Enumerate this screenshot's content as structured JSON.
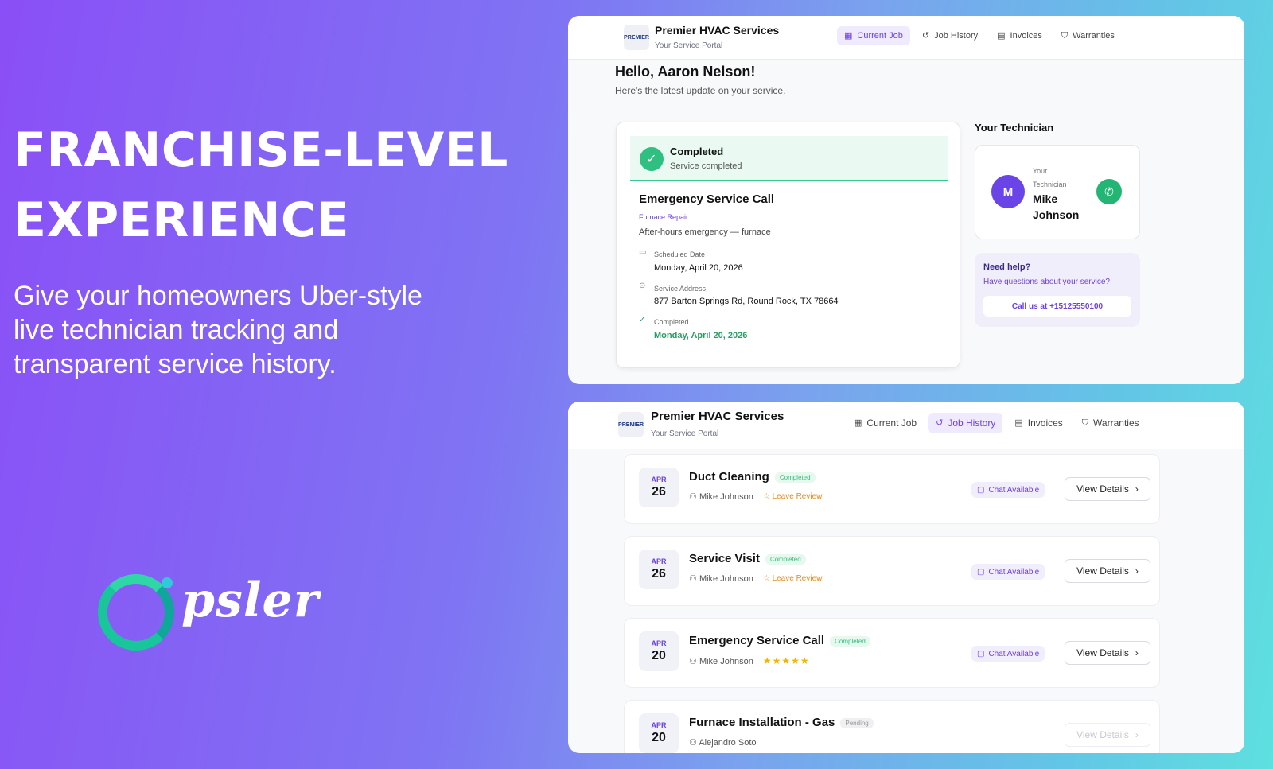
{
  "hero": {
    "headline_line1": "FRANCHISE-LEVEL",
    "headline_line2": "EXPERIENCE",
    "subtext": "Give your homeowners Uber-style live technician tracking and transparent service history."
  },
  "logo": {
    "text": "psler",
    "ring_color": "#19c59a"
  },
  "portal": {
    "brand_name": "Premier HVAC Services",
    "brand_sub": "Your Service Portal",
    "brand_logo_text": "PREMIER",
    "nav": {
      "current_job": "Current Job",
      "job_history": "Job History",
      "invoices": "Invoices",
      "warranties": "Warranties"
    },
    "accent_color": "#6d3fe6"
  },
  "current_job_view": {
    "greeting": "Hello, Aaron Nelson!",
    "greeting_sub": "Here's the latest update on your service.",
    "status_title": "Completed",
    "status_sub": "Service completed",
    "job_title": "Emergency Service Call",
    "job_category": "Furnace Repair",
    "job_description": "After-hours emergency — furnace",
    "scheduled_label": "Scheduled Date",
    "scheduled_value": "Monday, April 20, 2026",
    "address_label": "Service Address",
    "address_value": "877 Barton Springs Rd, Round Rock, TX 78664",
    "completed_label": "Completed",
    "completed_value": "Monday, April 20, 2026",
    "technician_heading": "Your Technician",
    "technician_label": "Your Technician",
    "technician_initial": "M",
    "technician_name": "Mike Johnson",
    "help_title": "Need help?",
    "help_question": "Have questions about your service?",
    "call_button": "Call us at +15125550100"
  },
  "job_history_view": {
    "chat_label": "Chat Available",
    "view_details_label": "View Details",
    "leave_review_label": "Leave Review",
    "rows": [
      {
        "month": "APR",
        "day": "26",
        "title": "Duct Cleaning",
        "status": "Completed",
        "technician": "Mike Johnson",
        "review": "Leave Review"
      },
      {
        "month": "APR",
        "day": "26",
        "title": "Service Visit",
        "status": "Completed",
        "technician": "Mike Johnson",
        "review": "Leave Review"
      },
      {
        "month": "APR",
        "day": "20",
        "title": "Emergency Service Call",
        "status": "Completed",
        "technician": "Mike Johnson",
        "rating": 5
      },
      {
        "month": "APR",
        "day": "20",
        "title": "Furnace Installation - Gas",
        "status": "Pending",
        "technician": "Alejandro Soto"
      }
    ]
  }
}
